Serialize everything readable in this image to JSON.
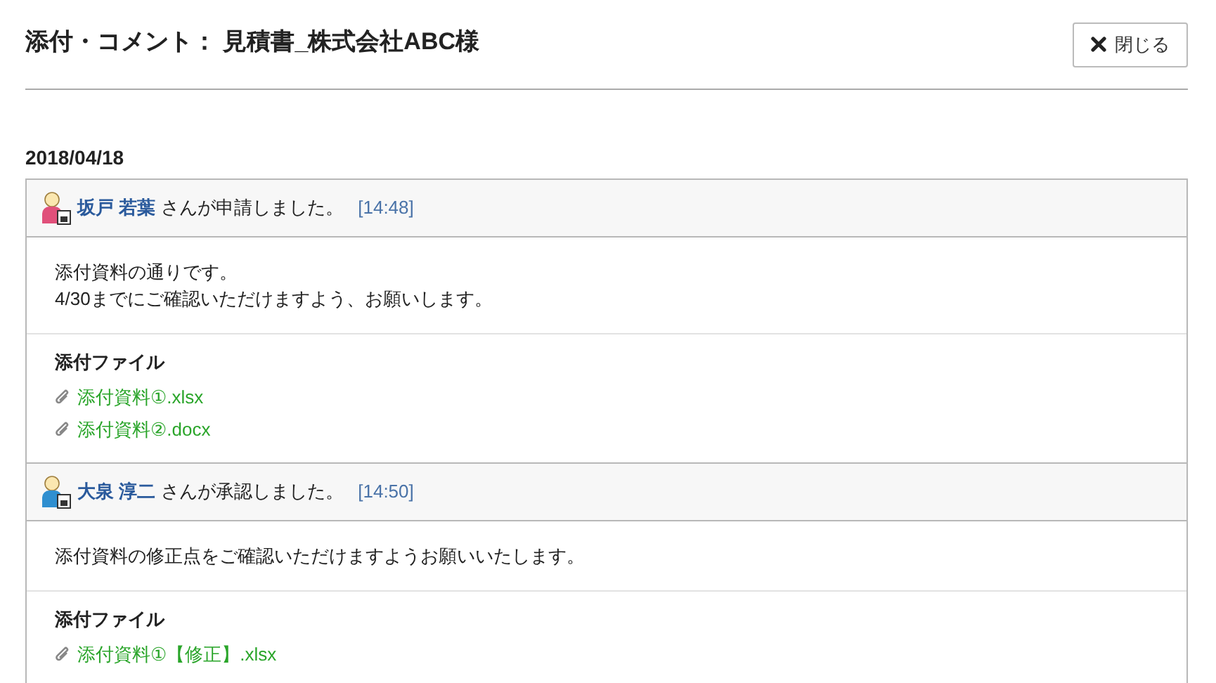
{
  "title": "添付・コメント： 見積書_株式会社ABC様",
  "close_button": {
    "label": "閉じる"
  },
  "date": "2018/04/18",
  "entries": [
    {
      "user": "坂戸 若葉",
      "action": "さんが申請しました。",
      "time": "[14:48]",
      "color": "#e0507a",
      "message": [
        "添付資料の通りです。",
        "4/30までにご確認いただけますよう、お願いします。"
      ],
      "files_heading": "添付ファイル",
      "files": [
        "添付資料①.xlsx",
        "添付資料②.docx"
      ]
    },
    {
      "user": "大泉 淳二",
      "action": "さんが承認しました。",
      "time": "[14:50]",
      "color": "#2f8fd0",
      "message": [
        "添付資料の修正点をご確認いただけますようお願いいたします。"
      ],
      "files_heading": "添付ファイル",
      "files": [
        "添付資料①【修正】.xlsx"
      ]
    }
  ]
}
